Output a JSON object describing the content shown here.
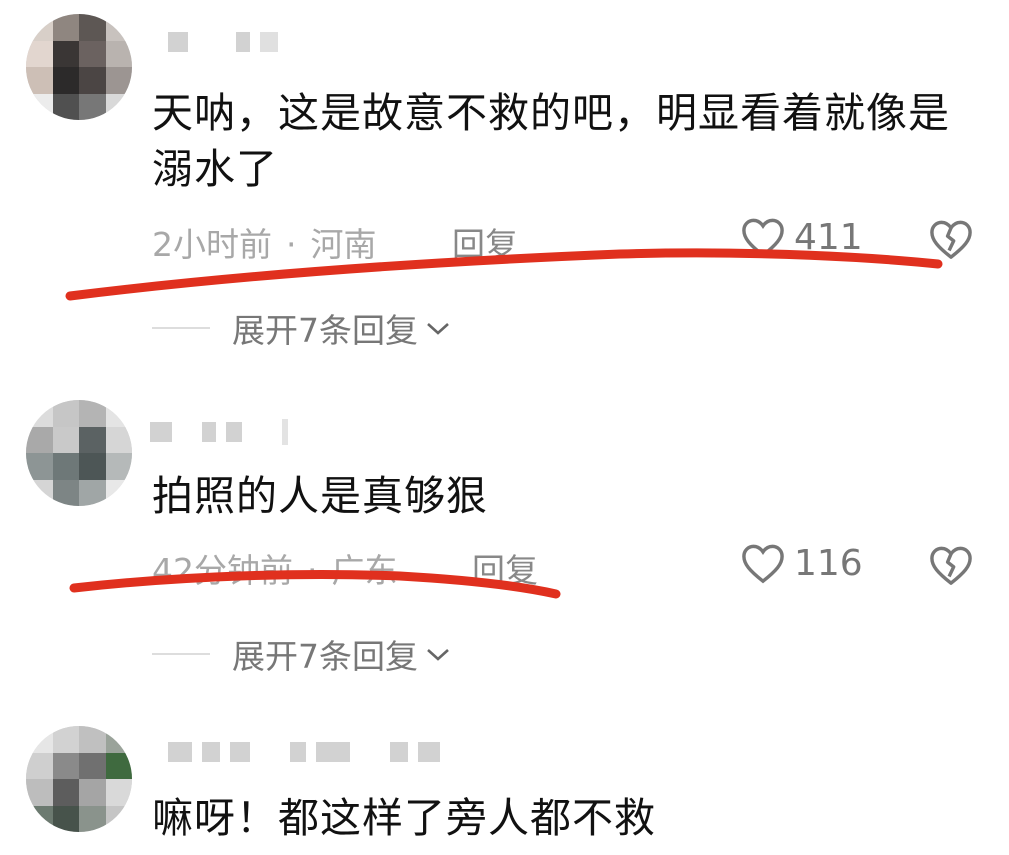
{
  "comments": [
    {
      "text": "天呐，这是故意不救的吧，明显看着就像是溺水了",
      "time": "2小时前",
      "location": "河南",
      "reply_label": "回复",
      "likes": "411",
      "expand_label": "展开7条回复"
    },
    {
      "text": "拍照的人是真够狠",
      "time": "42分钟前",
      "location": "广东",
      "reply_label": "回复",
      "likes": "116",
      "expand_label": "展开7条回复"
    },
    {
      "text": "嘛呀！都这样了旁人都不救"
    }
  ],
  "meta_separator": "·",
  "icons": {
    "like": "heart-outline-icon",
    "dislike": "broken-heart-icon",
    "expand": "chevron-down-icon"
  },
  "colors": {
    "annotation_red": "#e0301e",
    "meta_gray": "#a8a8a8"
  }
}
